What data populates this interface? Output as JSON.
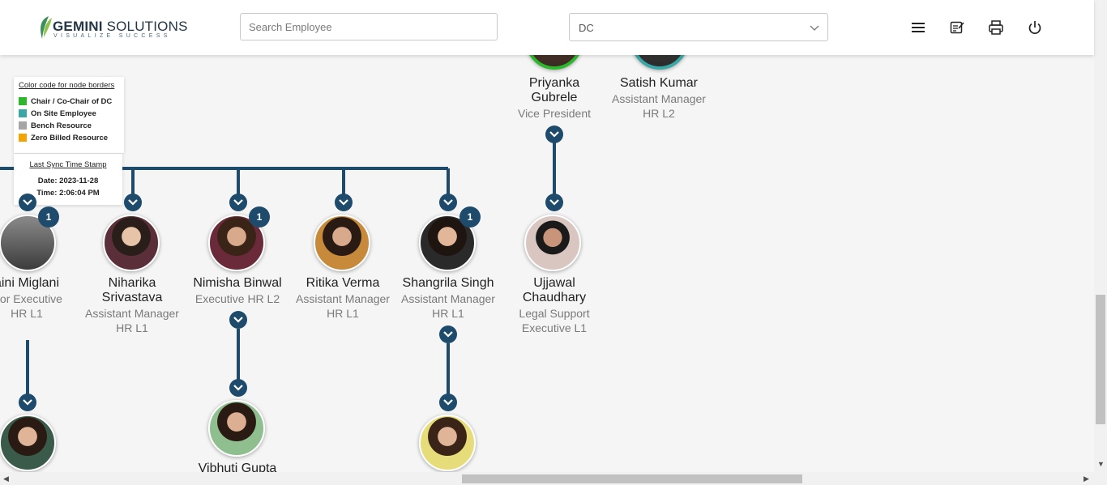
{
  "header": {
    "logo": {
      "brand_bold": "GEMINI",
      "brand_rest": " SOLUTIONS",
      "tagline": "VISUALIZE SUCCESS"
    },
    "search": {
      "placeholder": "Search Employee",
      "value": ""
    },
    "department_select": {
      "value": "DC"
    },
    "icons": [
      "menu-icon",
      "notes-icon",
      "printer-icon",
      "power-icon"
    ]
  },
  "legend": {
    "title": "Color code for node borders",
    "items": [
      {
        "label": "Chair / Co-Chair of DC",
        "color": "#2db72d"
      },
      {
        "label": "On Site Employee",
        "color": "#3aa6a6"
      },
      {
        "label": "Bench Resource",
        "color": "#a6a6a6"
      },
      {
        "label": "Zero Billed Resource",
        "color": "#f5a300"
      }
    ]
  },
  "sync": {
    "title": "Last Sync Time Stamp",
    "date": "Date: 2023-11-28",
    "time": "Time: 2:06:04 PM"
  },
  "colors": {
    "node_blue": "#1e4b6b",
    "chair_green": "#2db72d",
    "onsite_teal": "#3aa6a6"
  },
  "top_nodes": [
    {
      "name": "Priyanka Gubrele",
      "name_line1": "Priyanka",
      "name_line2": "Gubrele",
      "title": "Vice President"
    },
    {
      "name": "Satish Kumar",
      "title_line1": "Assistant Manager",
      "title_line2": "HR L2"
    }
  ],
  "nodes": [
    {
      "name": "aini Miglani",
      "title_line1": "nior Executive",
      "title_line2": "HR L1",
      "reports": "1"
    },
    {
      "name_line1": "Niharika",
      "name_line2": "Srivastava",
      "title_line1": "Assistant Manager",
      "title_line2": "HR L1"
    },
    {
      "name": "Nimisha Binwal",
      "title_line1": "Executive HR L2",
      "reports": "1"
    },
    {
      "name": "Ritika Verma",
      "title_line1": "Assistant Manager",
      "title_line2": "HR L1"
    },
    {
      "name": "Shangrila Singh",
      "title_line1": "Assistant Manager",
      "title_line2": "HR L1",
      "reports": "1"
    },
    {
      "name_line1": "Ujjawal",
      "name_line2": "Chaudhary",
      "title_line1": "Legal Support",
      "title_line2": "Executive L1"
    }
  ],
  "bottom_nodes": [
    {
      "name": "Vibhuti Gupta"
    }
  ]
}
